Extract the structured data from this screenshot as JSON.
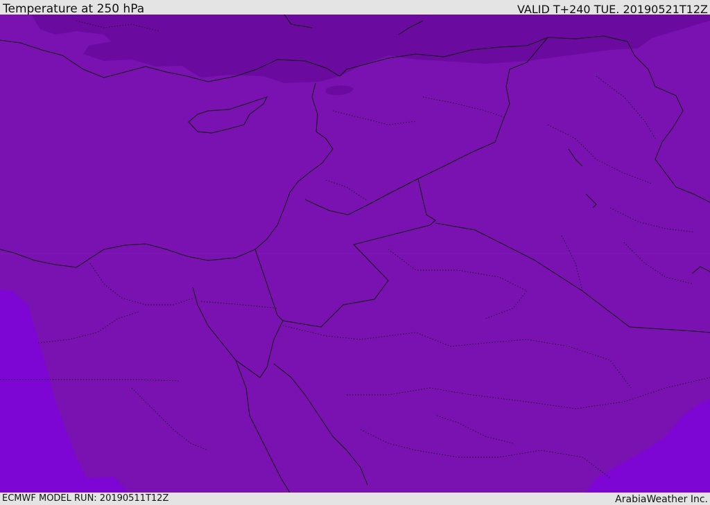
{
  "header": {
    "title": "Temperature at 250 hPa",
    "valid_time": "VALID T+240 TUE. 20190521T12Z"
  },
  "footer": {
    "model_run": "ECMWF MODEL RUN: 20190511T12Z",
    "credit": "ArabiaWeather Inc."
  },
  "map": {
    "colors": {
      "main_field": "#7912b1",
      "cold_band_north": "#6a0a9f",
      "warmer_edges": "#7d06d5",
      "borders": "#111111"
    }
  }
}
